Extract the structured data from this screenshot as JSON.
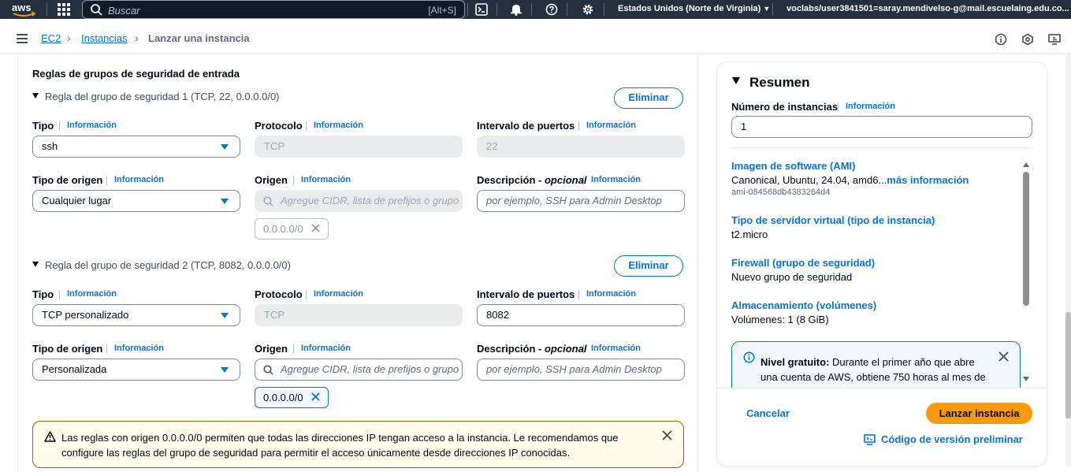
{
  "topbar": {
    "logo": "aws",
    "search_placeholder": "Buscar",
    "search_shortcut": "[Alt+S]",
    "region": "Estados Unidos (Norte de Virginia)",
    "account": "voclabs/user3841501=saray.mendivelso-g@mail.escuelaing.edu.co..."
  },
  "breadcrumb": {
    "items": [
      "EC2",
      "Instancias",
      "Lanzar una instancia"
    ]
  },
  "inbound": {
    "section_title": "Reglas de grupos de seguridad de entrada",
    "info": "Información",
    "delete_label": "Eliminar",
    "labels": {
      "type": "Tipo",
      "protocol": "Protocolo",
      "port_range": "Intervalo de puertos",
      "source_type": "Tipo de origen",
      "source": "Origen",
      "description": "Descripción",
      "optional": "opcional"
    },
    "source_placeholder": "Agregue CIDR, lista de prefijos o grupo de seguridad",
    "description_placeholder": "por ejemplo, SSH para Admin Desktop",
    "rules": [
      {
        "header": "Regla del grupo de seguridad 1 (TCP, 22, 0.0.0.0/0)",
        "type": "ssh",
        "protocol": "TCP",
        "port_range": "22",
        "source_type": "Cualquier lugar",
        "source_token": "0.0.0.0/0"
      },
      {
        "header": "Regla del grupo de seguridad 2 (TCP, 8082, 0.0.0.0/0)",
        "type": "TCP personalizado",
        "protocol": "TCP",
        "port_range": "8082",
        "source_type": "Personalizada",
        "source_token": "0.0.0.0/0"
      }
    ],
    "warning": "Las reglas con origen 0.0.0.0/0 permiten que todas las direcciones IP tengan acceso a la instancia. Le recomendamos que configure las reglas del grupo de seguridad para permitir el acceso únicamente desde direcciones IP conocidas."
  },
  "summary": {
    "title": "Resumen",
    "instances_label": "Número de instancias",
    "info": "Información",
    "instances_value": "1",
    "ami_label": "Imagen de software (AMI)",
    "ami_value": "Canonical, Ubuntu, 24.04, amd6...",
    "ami_more": "más información",
    "ami_id": "ami-084568db4383264d4",
    "instance_type_label": "Tipo de servidor virtual (tipo de instancia)",
    "instance_type_value": "t2.micro",
    "firewall_label": "Firewall (grupo de seguridad)",
    "firewall_value": "Nuevo grupo de seguridad",
    "storage_label": "Almacenamiento (volúmenes)",
    "storage_value": "Volúmenes: 1 (8 GiB)",
    "free_tier_title": "Nivel gratuito:",
    "free_tier_text": "Durante el primer año que abre una cuenta de AWS, obtiene 750 horas al mes de",
    "cancel": "Cancelar",
    "launch": "Lanzar instancia",
    "preview": "Código de versión preliminar"
  },
  "colors": {
    "topbar": "#232f3e",
    "link": "#0972d3",
    "primary_button": "#ff9900",
    "warning_border": "#8d6605",
    "warning_bg": "#fffce9"
  }
}
